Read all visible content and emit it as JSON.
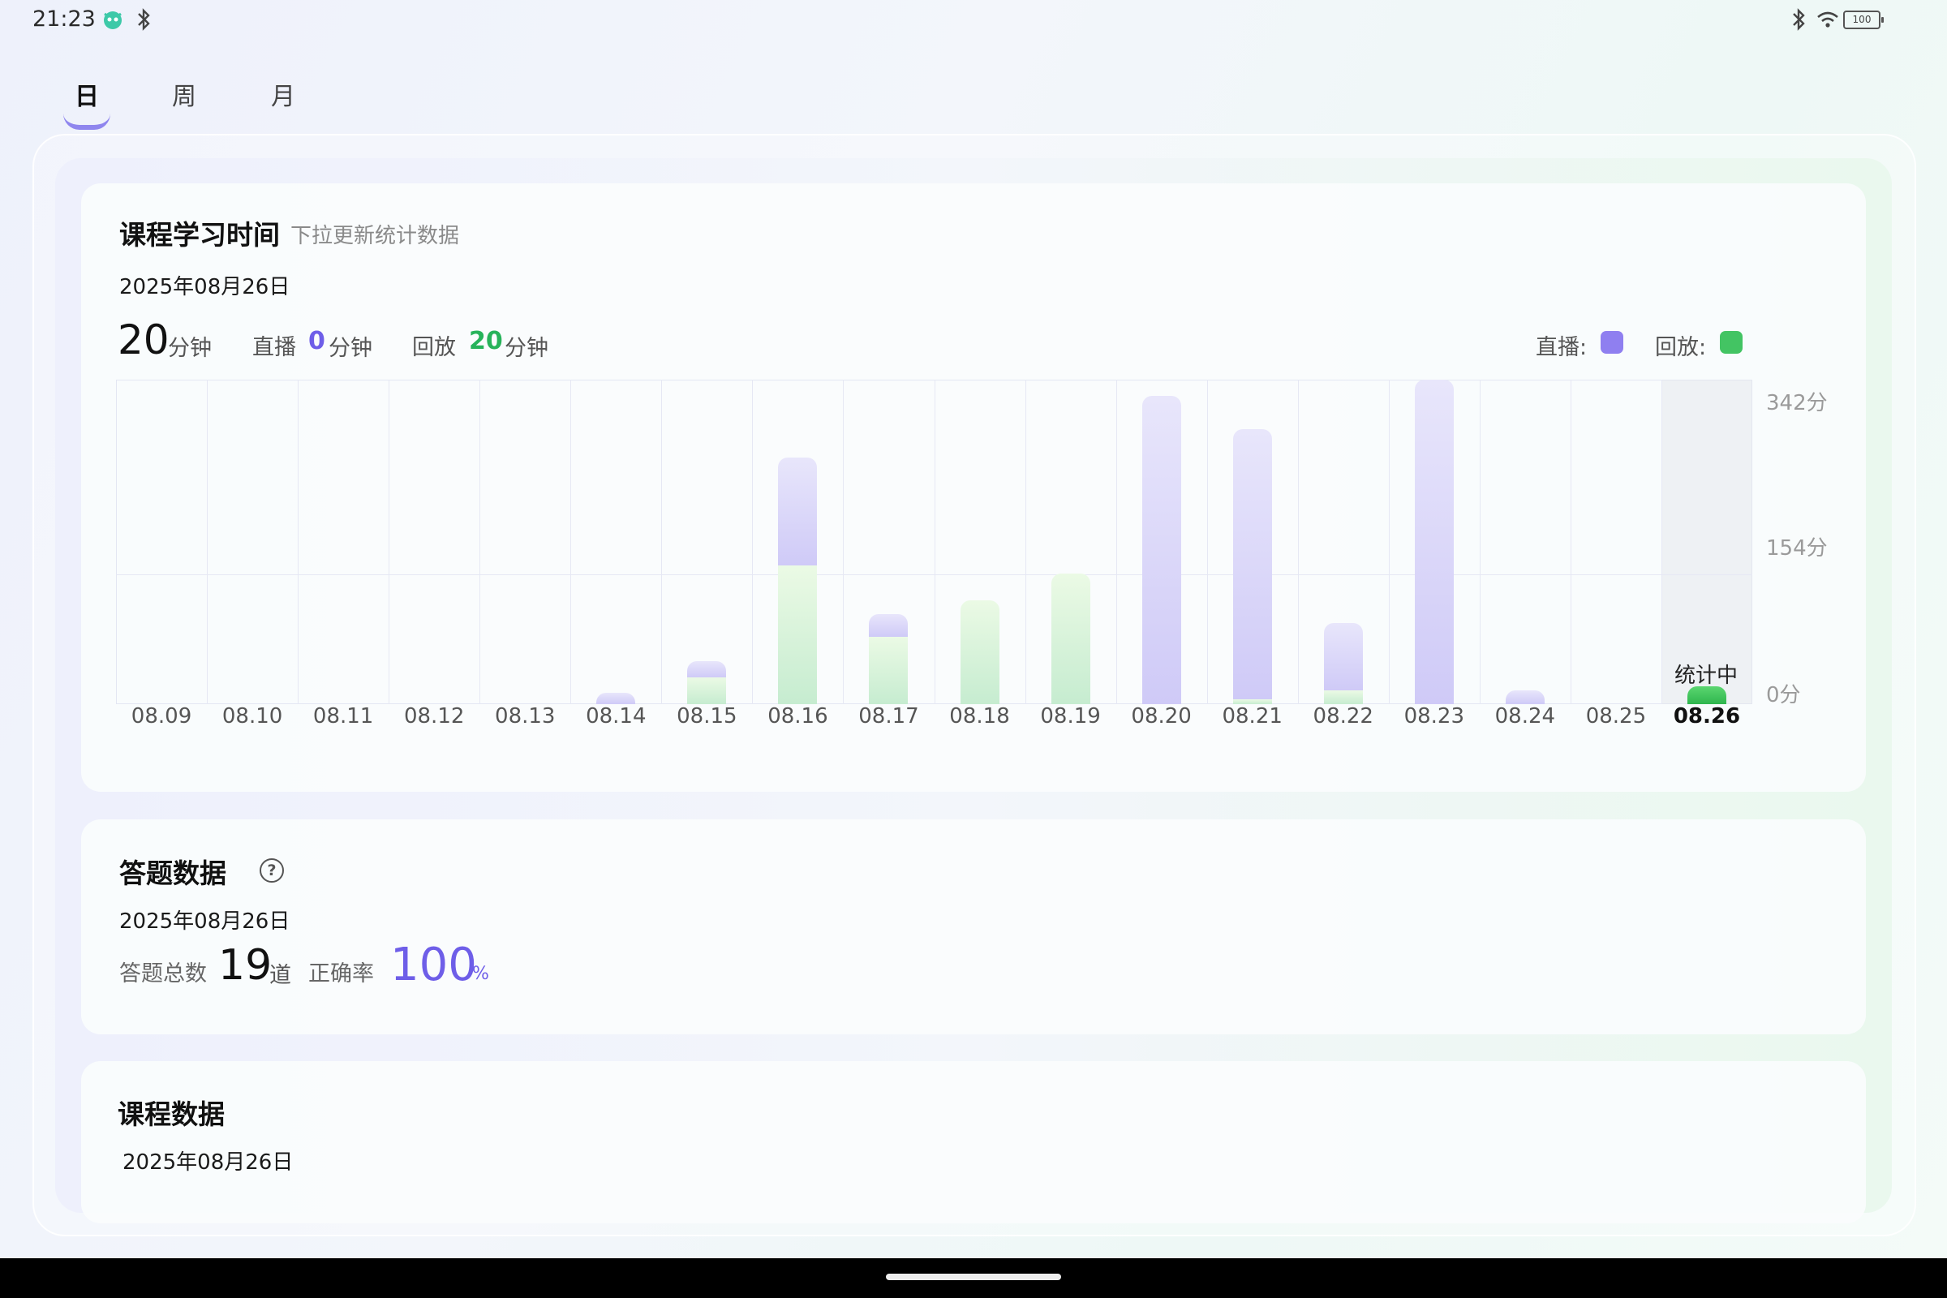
{
  "status_bar": {
    "time": "21:23",
    "battery": "100"
  },
  "tabs": [
    {
      "label": "日",
      "active": true
    },
    {
      "label": "周",
      "active": false
    },
    {
      "label": "月",
      "active": false
    }
  ],
  "study_time_card": {
    "title": "课程学习时间",
    "subtitle": "下拉更新统计数据",
    "date": "2025年08月26日",
    "total_value": "20",
    "total_unit": "分钟",
    "live_label": "直播",
    "live_value": "0",
    "live_unit": "分钟",
    "replay_label": "回放",
    "replay_value": "20",
    "replay_unit": "分钟",
    "legend_live": "直播:",
    "legend_replay": "回放:",
    "current_status": "统计中",
    "colors": {
      "live": "#8f7ff0",
      "replay": "#43c463"
    }
  },
  "chart_data": {
    "type": "bar",
    "stacked": true,
    "categories": [
      "08.09",
      "08.10",
      "08.11",
      "08.12",
      "08.13",
      "08.14",
      "08.15",
      "08.16",
      "08.17",
      "08.18",
      "08.19",
      "08.20",
      "08.21",
      "08.22",
      "08.23",
      "08.24",
      "08.25",
      "08.26"
    ],
    "series": [
      {
        "name": "直播",
        "values": [
          0,
          0,
          0,
          0,
          0,
          12,
          18,
          120,
          25,
          0,
          0,
          342,
          300,
          75,
          360,
          15,
          0,
          0
        ]
      },
      {
        "name": "回放",
        "values": [
          0,
          0,
          0,
          0,
          0,
          0,
          30,
          154,
          75,
          115,
          145,
          0,
          5,
          15,
          0,
          0,
          0,
          20
        ]
      }
    ],
    "y_ticks": [
      "342分",
      "154分",
      "0分"
    ],
    "ylim": [
      0,
      342
    ],
    "grid": true,
    "highlight_category": "08.26"
  },
  "answer_card": {
    "title": "答题数据",
    "date": "2025年08月26日",
    "total_label": "答题总数",
    "total_value": "19",
    "total_unit": "道",
    "accuracy_label": "正确率",
    "accuracy_value": "100",
    "accuracy_unit": "%",
    "help_icon": "?"
  },
  "course_card": {
    "title": "课程数据",
    "date": "2025年08月26日"
  }
}
